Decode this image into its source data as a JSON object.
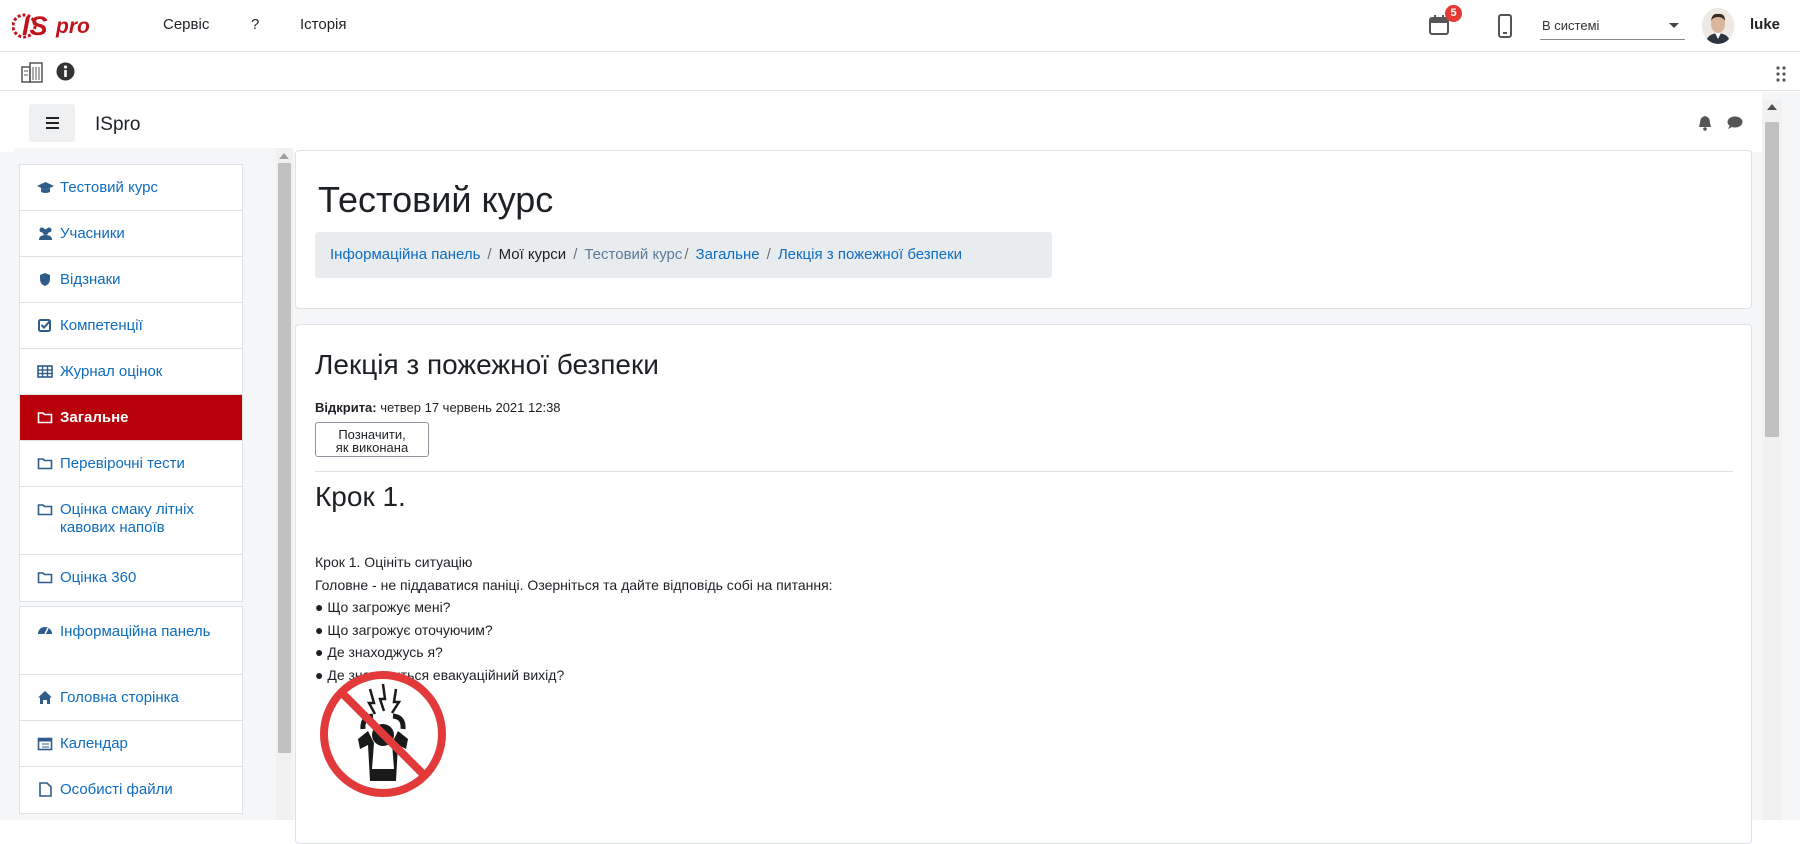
{
  "topbar": {
    "menu": [
      "Сервіс",
      "?",
      "Історія"
    ],
    "notifications_count": "5",
    "status": "В системі",
    "username": "luke"
  },
  "brand": "ISpro",
  "sidebar": {
    "items": [
      {
        "label": "Тестовий курс",
        "icon": "graduation-cap-icon"
      },
      {
        "label": "Учасники",
        "icon": "users-icon"
      },
      {
        "label": "Відзнаки",
        "icon": "shield-icon"
      },
      {
        "label": "Компетенції",
        "icon": "checkbox-icon"
      },
      {
        "label": "Журнал оцінок",
        "icon": "table-icon"
      },
      {
        "label": "Загальне",
        "icon": "folder-icon",
        "active": true
      },
      {
        "label": "Перевірочні тести",
        "icon": "folder-icon"
      },
      {
        "label": "Оцінка смаку літніх кавових напоїв",
        "icon": "folder-icon"
      },
      {
        "label": "Оцінка 360",
        "icon": "folder-icon"
      }
    ],
    "items2": [
      {
        "label": "Інформаційна панель",
        "icon": "dashboard-icon"
      },
      {
        "label": "Головна сторінка",
        "icon": "home-icon"
      },
      {
        "label": "Календар",
        "icon": "calendar-icon"
      },
      {
        "label": "Особисті файли",
        "icon": "file-icon"
      }
    ]
  },
  "header": {
    "course_title": "Тестовий курс",
    "breadcrumb": [
      "Інформаційна панель",
      "Мої курси",
      "Тестовий курс",
      "Загальне",
      "Лекція з пожежної безпеки"
    ]
  },
  "page": {
    "title": "Лекція з пожежної безпеки",
    "opened_label": "Відкрита:",
    "opened_value": "четвер 17 червень 2021 12:38",
    "done_button_line1": "Позначити,",
    "done_button_line2": "як виконана",
    "step_heading": "Крок 1.",
    "lines": [
      "Крок 1. Оцініть ситуацію",
      "Головне - не піддаватися паніці. Озерніться та дайте відповідь собі на питання:",
      "● Що загрожує мені?",
      "● Що загрожує оточуючим?",
      "● Де знаходжусь я?",
      "● Де знаходиться евакуаційний вихід?"
    ]
  },
  "colors": {
    "active": "#b8000a",
    "link": "#0f6cbf",
    "badge": "#e53935"
  }
}
